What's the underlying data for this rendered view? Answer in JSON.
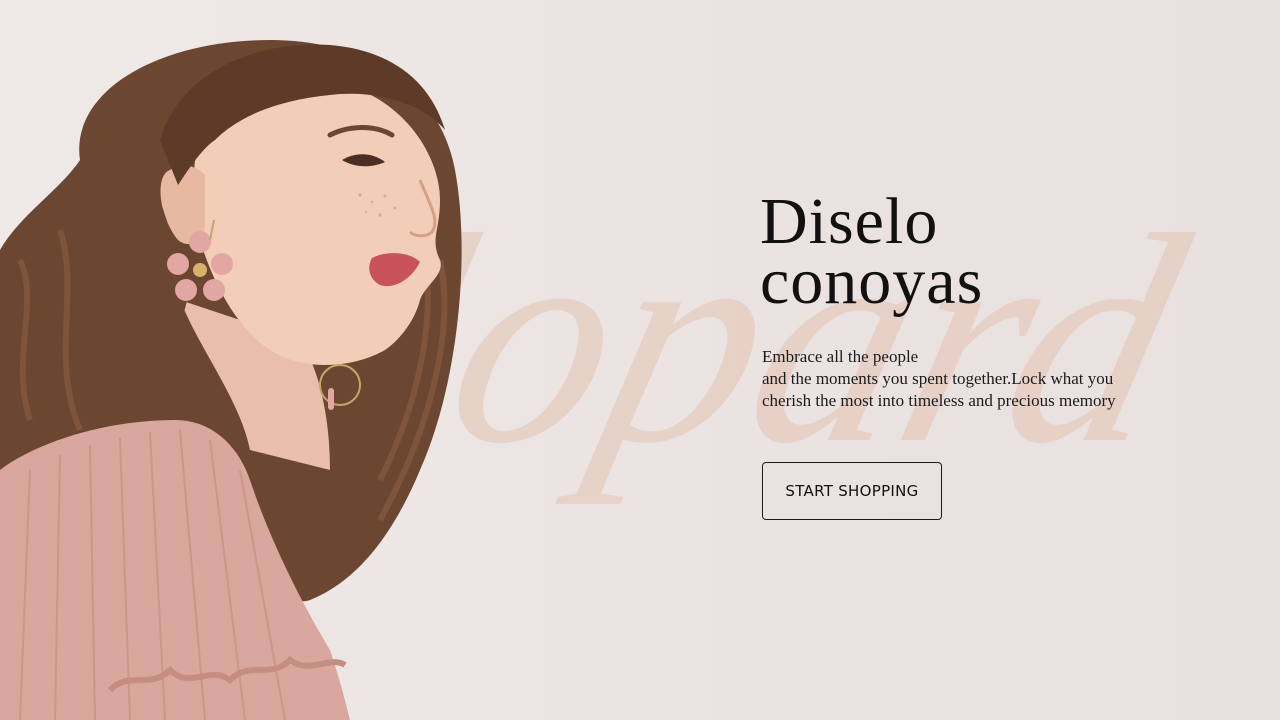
{
  "hero": {
    "headline_line1": "Diselo",
    "headline_line2": "conoyas",
    "tagline_line1": "Embrace all the people",
    "tagline_line2": "and the moments you spent together.Lock what you",
    "tagline_line3": "cherish the most into timeless and precious memory",
    "cta_label": "START SHOPPING",
    "watermark_text": "lopard"
  },
  "colors": {
    "background": "#ebe3e1",
    "watermark": "#e7cfc2",
    "text": "#111111",
    "blouse": "#d9a79d",
    "hair": "#6b4631"
  }
}
